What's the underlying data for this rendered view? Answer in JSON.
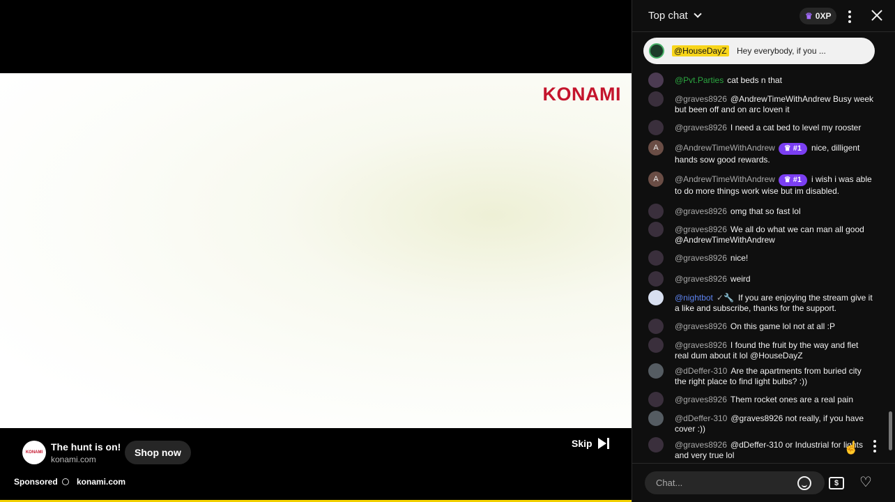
{
  "video": {
    "brand_logo": "KONAMI",
    "ad_title": "The hunt is on!",
    "ad_domain": "konami.com",
    "shop_button": "Shop now",
    "skip_label": "Skip",
    "sponsored_label": "Sponsored",
    "sponsored_domain": "konami.com"
  },
  "chat": {
    "title": "Top chat",
    "xp": "0XP",
    "pinned": {
      "author": "@HouseDayZ",
      "text": "Hey everybody, if you ..."
    },
    "messages": [
      {
        "author": "@Pvt.Parties",
        "rank": "",
        "text": "cat beds n that",
        "avatar": "party"
      },
      {
        "author": "@graves8926",
        "rank": "",
        "text": "@AndrewTimeWithAndrew Busy week but been off and on arc loven it",
        "avatar": "graves"
      },
      {
        "author": "@graves8926",
        "rank": "",
        "text": "I need a cat bed to level my rooster",
        "avatar": "graves"
      },
      {
        "author": "@AndrewTimeWithAndrew",
        "rank": "#1",
        "text": "nice, dilligent hands sow good rewards.",
        "avatar": "A"
      },
      {
        "author": "@AndrewTimeWithAndrew",
        "rank": "#1",
        "text": "i wish i was able to do more things work wise but im disabled.",
        "avatar": "A"
      },
      {
        "author": "@graves8926",
        "rank": "",
        "text": "omg that so fast lol",
        "avatar": "graves"
      },
      {
        "author": "@graves8926",
        "rank": "",
        "text": "We all do what we can man all good @AndrewTimeWithAndrew",
        "avatar": "graves"
      },
      {
        "author": "@graves8926",
        "rank": "",
        "text": "nice!",
        "avatar": "graves"
      },
      {
        "author": "@graves8926",
        "rank": "",
        "text": "weird",
        "avatar": "graves"
      },
      {
        "author": "@nightbot",
        "rank": "",
        "text": "If you are enjoying the stream give it a like and subscribe, thanks for the support.",
        "avatar": "bot"
      },
      {
        "author": "@graves8926",
        "rank": "",
        "text": "On this game lol not at all :P",
        "avatar": "graves"
      },
      {
        "author": "@graves8926",
        "rank": "",
        "text": "I found the fruit by the way and flet real dum about it lol @HouseDayZ",
        "avatar": "graves"
      },
      {
        "author": "@dDeffer-310",
        "rank": "",
        "text": "Are the apartments from buried city the right place to find light bulbs? :))",
        "avatar": "deffer"
      },
      {
        "author": "@graves8926",
        "rank": "",
        "text": "Them rocket ones are a real pain",
        "avatar": "graves"
      },
      {
        "author": "@dDeffer-310",
        "rank": "",
        "text": "@graves8926 not really, if you have cover :))",
        "avatar": "deffer"
      },
      {
        "author": "@graves8926",
        "rank": "",
        "text": "@dDeffer-310 or Industrial for lights and very true lol",
        "avatar": "graves"
      }
    ],
    "input_placeholder": "Chat..."
  }
}
